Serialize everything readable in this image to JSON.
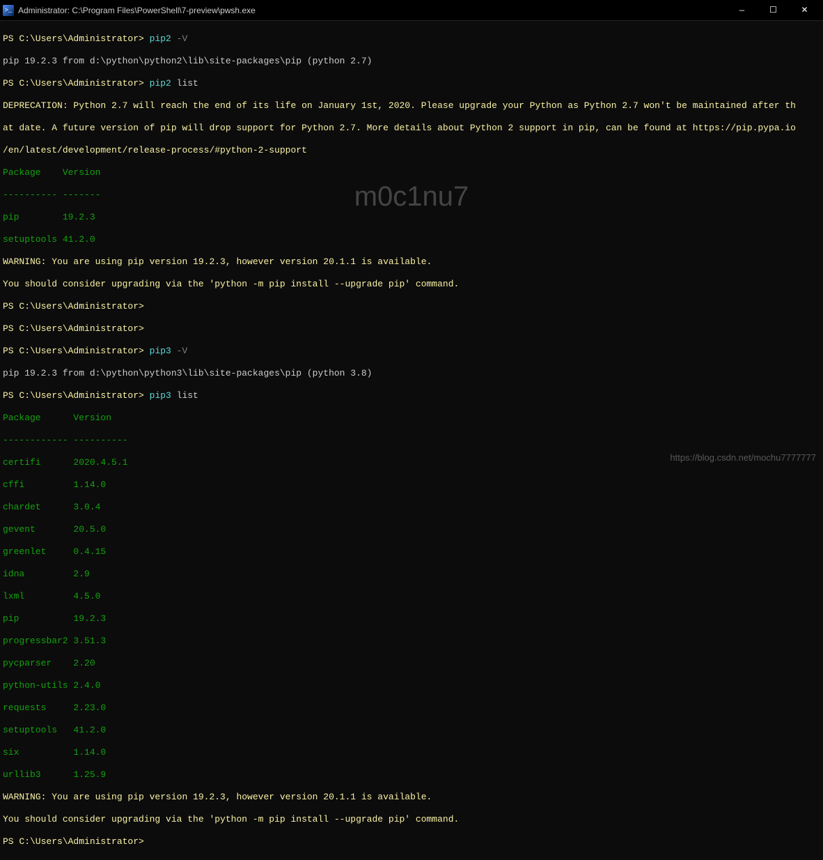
{
  "titlebar": {
    "title": "Administrator: C:\\Program Files\\PowerShell\\7-preview\\pwsh.exe",
    "min": "—",
    "max": "☐",
    "close": "✕"
  },
  "watermark": "m0c1nu7",
  "footer_url": "https://blog.csdn.net/mochu7777777",
  "lines": {
    "l1_prompt": "PS C:\\Users\\Administrator> ",
    "l1_cmd": "pip2 ",
    "l1_flag": "-V",
    "l2": "pip 19.2.3 from d:\\python\\python2\\lib\\site-packages\\pip (python 2.7)",
    "l3_prompt": "PS C:\\Users\\Administrator> ",
    "l3_cmd": "pip2 ",
    "l3_arg": "list",
    "l4": "DEPRECATION: Python 2.7 will reach the end of its life on January 1st, 2020. Please upgrade your Python as Python 2.7 won't be maintained after th",
    "l5": "at date. A future version of pip will drop support for Python 2.7. More details about Python 2 support in pip, can be found at https://pip.pypa.io",
    "l6": "/en/latest/development/release-process/#python-2-support",
    "l7": "Package    Version",
    "l8": "---------- -------",
    "l9": "pip        19.2.3",
    "l10": "setuptools 41.2.0",
    "l11": "WARNING: You are using pip version 19.2.3, however version 20.1.1 is available.",
    "l12": "You should consider upgrading via the 'python -m pip install --upgrade pip' command.",
    "l13_prompt": "PS C:\\Users\\Administrator>",
    "l14_prompt": "PS C:\\Users\\Administrator>",
    "l15_prompt": "PS C:\\Users\\Administrator> ",
    "l15_cmd": "pip3 ",
    "l15_flag": "-V",
    "l16": "pip 19.2.3 from d:\\python\\python3\\lib\\site-packages\\pip (python 3.8)",
    "l17_prompt": "PS C:\\Users\\Administrator> ",
    "l17_cmd": "pip3 ",
    "l17_arg": "list",
    "l18": "Package      Version",
    "l19": "------------ ----------",
    "l20": "certifi      2020.4.5.1",
    "l21": "cffi         1.14.0",
    "l22": "chardet      3.0.4",
    "l23": "gevent       20.5.0",
    "l24": "greenlet     0.4.15",
    "l25": "idna         2.9",
    "l26": "lxml         4.5.0",
    "l27": "pip          19.2.3",
    "l28": "progressbar2 3.51.3",
    "l29": "pycparser    2.20",
    "l30": "python-utils 2.4.0",
    "l31": "requests     2.23.0",
    "l32": "setuptools   41.2.0",
    "l33": "six          1.14.0",
    "l34": "urllib3      1.25.9",
    "l35": "WARNING: You are using pip version 19.2.3, however version 20.1.1 is available.",
    "l36": "You should consider upgrading via the 'python -m pip install --upgrade pip' command.",
    "l37_prompt": "PS C:\\Users\\Administrator>"
  }
}
